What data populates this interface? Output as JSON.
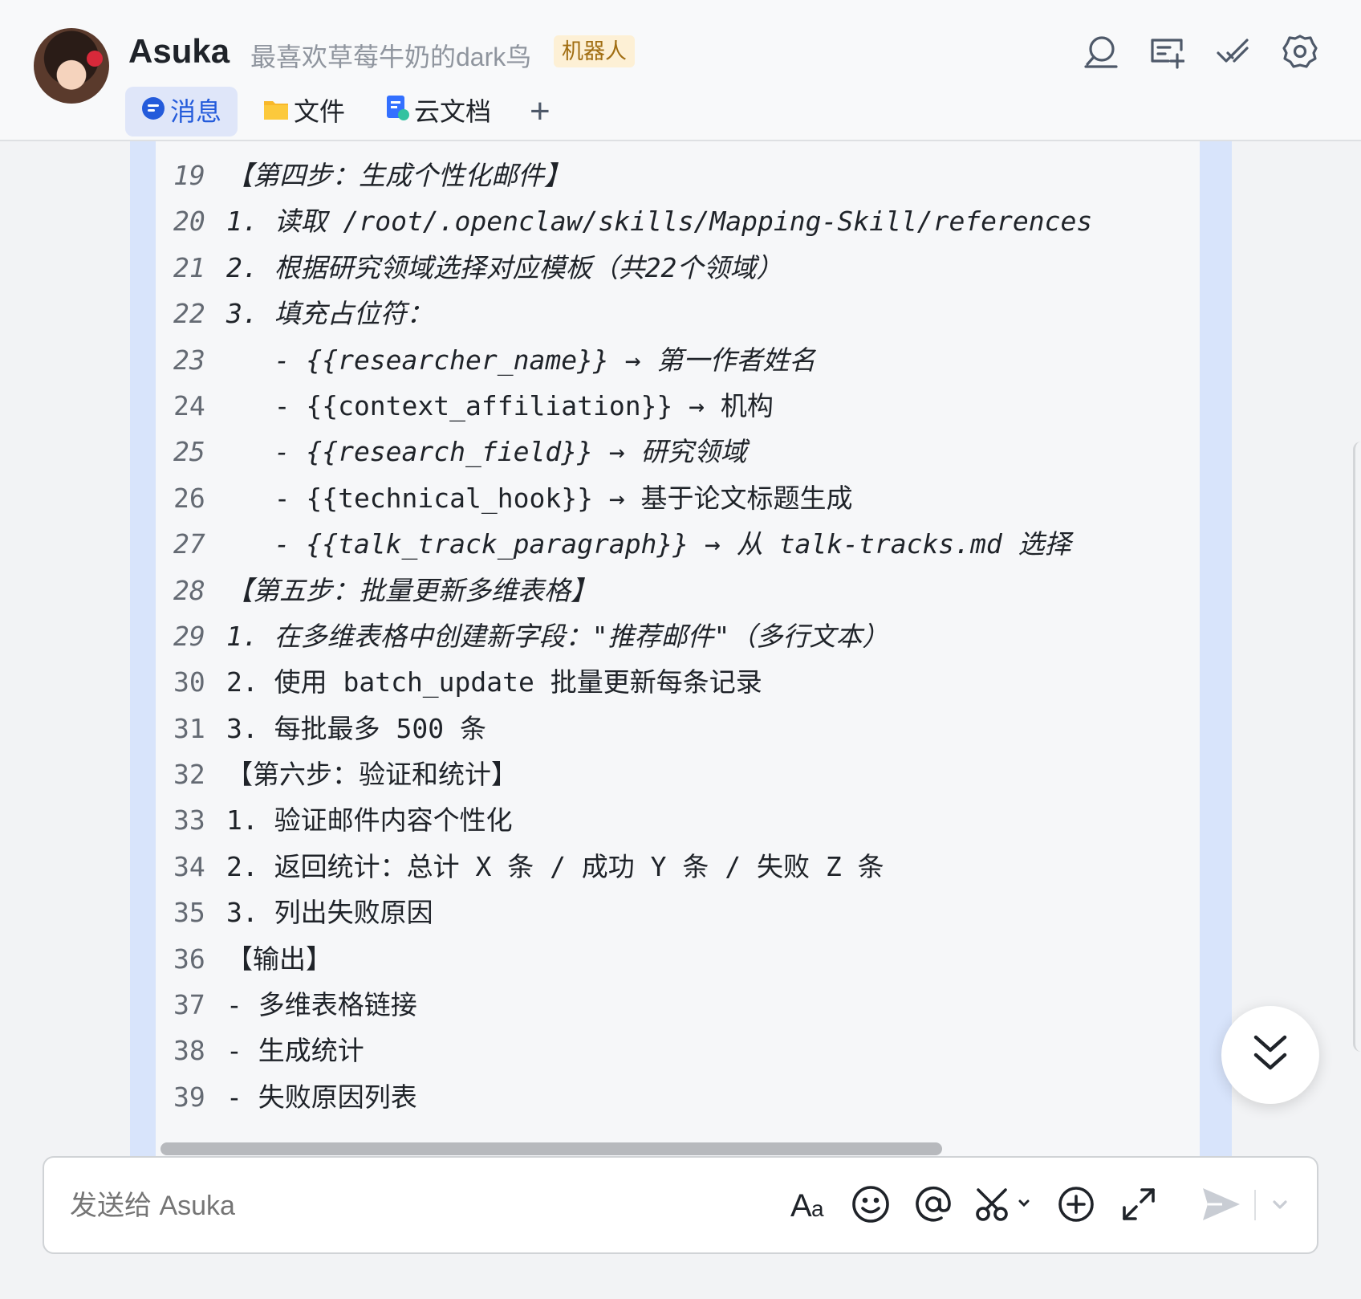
{
  "header": {
    "name": "Asuka",
    "signature": "最喜欢草莓牛奶的dark鸟",
    "badge": "机器人"
  },
  "tabs": [
    {
      "label": "消息",
      "active": true,
      "icon": "message-icon"
    },
    {
      "label": "文件",
      "active": false,
      "icon": "folder-icon"
    },
    {
      "label": "云文档",
      "active": false,
      "icon": "doc-icon"
    }
  ],
  "tab_add": "+",
  "code": {
    "lines": [
      {
        "n": "19",
        "text": "【第四步：生成个性化邮件】"
      },
      {
        "n": "20",
        "text": "1. 读取 /root/.openclaw/skills/Mapping-Skill/references"
      },
      {
        "n": "21",
        "text": "2. 根据研究领域选择对应模板（共22个领域）"
      },
      {
        "n": "22",
        "text": "3. 填充占位符："
      },
      {
        "n": "23",
        "text": "   - {{researcher_name}} → 第一作者姓名"
      },
      {
        "n": "24",
        "text": "   - {{context_affiliation}} → 机构"
      },
      {
        "n": "25",
        "text": "   - {{research_field}} → 研究领域"
      },
      {
        "n": "26",
        "text": "   - {{technical_hook}} → 基于论文标题生成"
      },
      {
        "n": "27",
        "text": "   - {{talk_track_paragraph}} → 从 talk-tracks.md 选择"
      },
      {
        "n": "28",
        "text": "【第五步：批量更新多维表格】"
      },
      {
        "n": "29",
        "text": "1. 在多维表格中创建新字段：\"推荐邮件\"（多行文本）"
      },
      {
        "n": "30",
        "text": "2. 使用 batch_update 批量更新每条记录"
      },
      {
        "n": "31",
        "text": "3. 每批最多 500 条"
      },
      {
        "n": "32",
        "text": "【第六步：验证和统计】"
      },
      {
        "n": "33",
        "text": "1. 验证邮件内容个性化"
      },
      {
        "n": "34",
        "text": "2. 返回统计：总计 X 条 / 成功 Y 条 / 失败 Z 条"
      },
      {
        "n": "35",
        "text": "3. 列出失败原因"
      },
      {
        "n": "36",
        "text": "【输出】"
      },
      {
        "n": "37",
        "text": "- 多维表格链接"
      },
      {
        "n": "38",
        "text": "- 生成统计"
      },
      {
        "n": "39",
        "text": "- 失败原因列表"
      }
    ]
  },
  "composer": {
    "placeholder": "发送给 Asuka"
  },
  "colors": {
    "accent": "#245bdb",
    "bubble": "#d8e4fb",
    "code_bg": "#f6f7f9",
    "badge_bg": "#fdf0d5",
    "badge_text": "#a16e12"
  },
  "icons": {
    "header": [
      "search-icon",
      "add-group-icon",
      "task-check-icon",
      "settings-gear-icon"
    ],
    "composer": [
      "text-format-icon",
      "emoji-icon",
      "mention-icon",
      "screenshot-scissors-icon",
      "plus-circle-icon",
      "expand-icon",
      "send-icon",
      "chevron-down-icon"
    ],
    "scroll": "double-chevron-down-icon"
  }
}
